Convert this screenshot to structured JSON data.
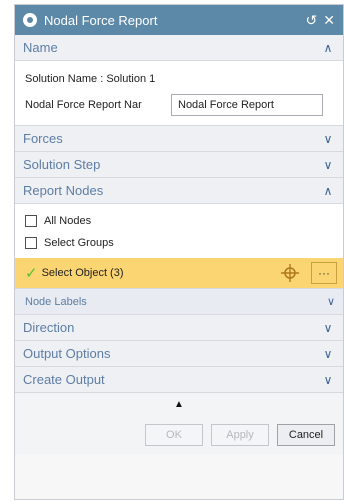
{
  "dialog": {
    "title": "Nodal Force Report",
    "reset_glyph": "↺",
    "close_glyph": "✕",
    "icons": {
      "title": "settings-icon",
      "reset": "reset-icon",
      "close": "close-icon"
    }
  },
  "sections": {
    "name": {
      "label": "Name",
      "chevron": "∧",
      "solution_name": "Solution Name : Solution 1",
      "report_name_label": "Nodal Force Report Nar",
      "report_name_value": "Nodal Force Report"
    },
    "forces": {
      "label": "Forces",
      "chevron": "∨"
    },
    "solution_step": {
      "label": "Solution Step",
      "chevron": "∨"
    },
    "report_nodes": {
      "label": "Report Nodes",
      "chevron": "∧",
      "all_nodes": "All Nodes",
      "select_groups": "Select Groups",
      "select_object": "Select Object (3)",
      "select_object_check": "✓",
      "more_glyph": "···",
      "node_labels": "Node Labels",
      "node_labels_chevron": "∨"
    },
    "direction": {
      "label": "Direction",
      "chevron": "∨"
    },
    "output_options": {
      "label": "Output Options",
      "chevron": "∨"
    },
    "create_output": {
      "label": "Create Output",
      "chevron": "∨"
    }
  },
  "collapse_glyph": "▲",
  "footer": {
    "ok": "OK",
    "apply": "Apply",
    "cancel": "Cancel"
  },
  "colors": {
    "titlebar": "#5c89a8",
    "section_text": "#5d7da4",
    "selection_highlight": "#fbd571",
    "check_green": "#5bbf2a"
  }
}
